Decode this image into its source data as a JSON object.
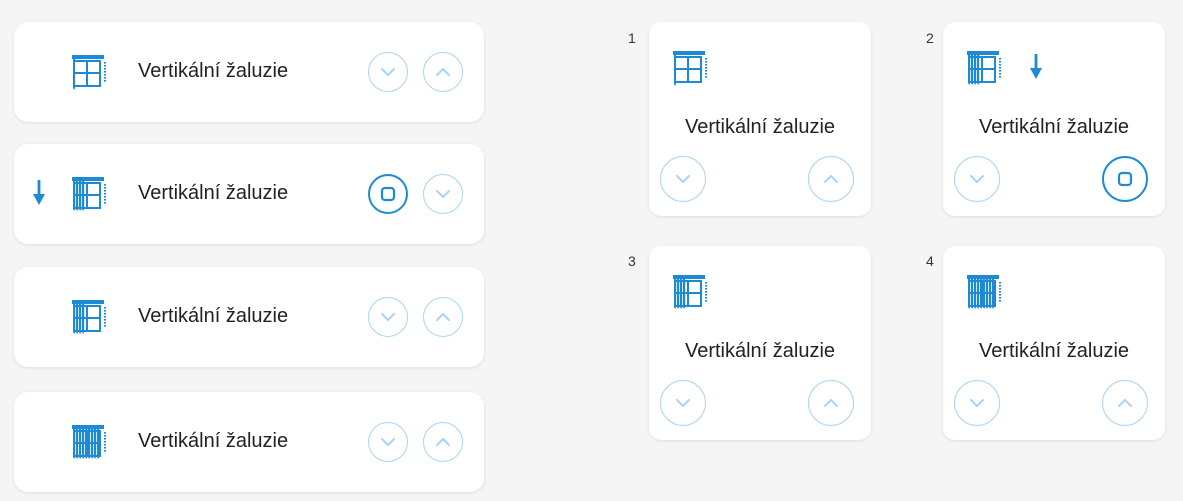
{
  "colors": {
    "accent": "#1e8ad6",
    "button_border": "#a9d4f3",
    "card": "#ffffff",
    "background": "#f5f5f5"
  },
  "list": [
    {
      "label": "Vertikální žaluzie",
      "state": "open",
      "icon": "blind-open-icon",
      "show_down_arrow": false,
      "buttons": [
        "chevron-down-icon",
        "chevron-up-icon"
      ]
    },
    {
      "label": "Vertikální žaluzie",
      "state": "closing",
      "icon": "blind-half-icon",
      "show_down_arrow": true,
      "buttons": [
        "stop-icon",
        "chevron-down-icon"
      ]
    },
    {
      "label": "Vertikální žaluzie",
      "state": "half",
      "icon": "blind-half-icon",
      "show_down_arrow": false,
      "buttons": [
        "chevron-down-icon",
        "chevron-up-icon"
      ]
    },
    {
      "label": "Vertikální žaluzie",
      "state": "closed",
      "icon": "blind-closed-icon",
      "show_down_arrow": false,
      "buttons": [
        "chevron-down-icon",
        "chevron-up-icon"
      ]
    }
  ],
  "tiles": [
    {
      "number": "1",
      "label": "Vertikální žaluzie",
      "icon": "blind-open-icon",
      "show_down_arrow": false,
      "buttons": [
        "chevron-down-icon",
        "chevron-up-icon"
      ]
    },
    {
      "number": "2",
      "label": "Vertikální žaluzie",
      "icon": "blind-half-icon",
      "show_down_arrow": true,
      "buttons": [
        "chevron-down-icon",
        "stop-icon"
      ]
    },
    {
      "number": "3",
      "label": "Vertikální žaluzie",
      "icon": "blind-half-icon",
      "show_down_arrow": false,
      "buttons": [
        "chevron-down-icon",
        "chevron-up-icon"
      ]
    },
    {
      "number": "4",
      "label": "Vertikální žaluzie",
      "icon": "blind-closed-icon",
      "show_down_arrow": false,
      "buttons": [
        "chevron-down-icon",
        "chevron-up-icon"
      ]
    }
  ]
}
